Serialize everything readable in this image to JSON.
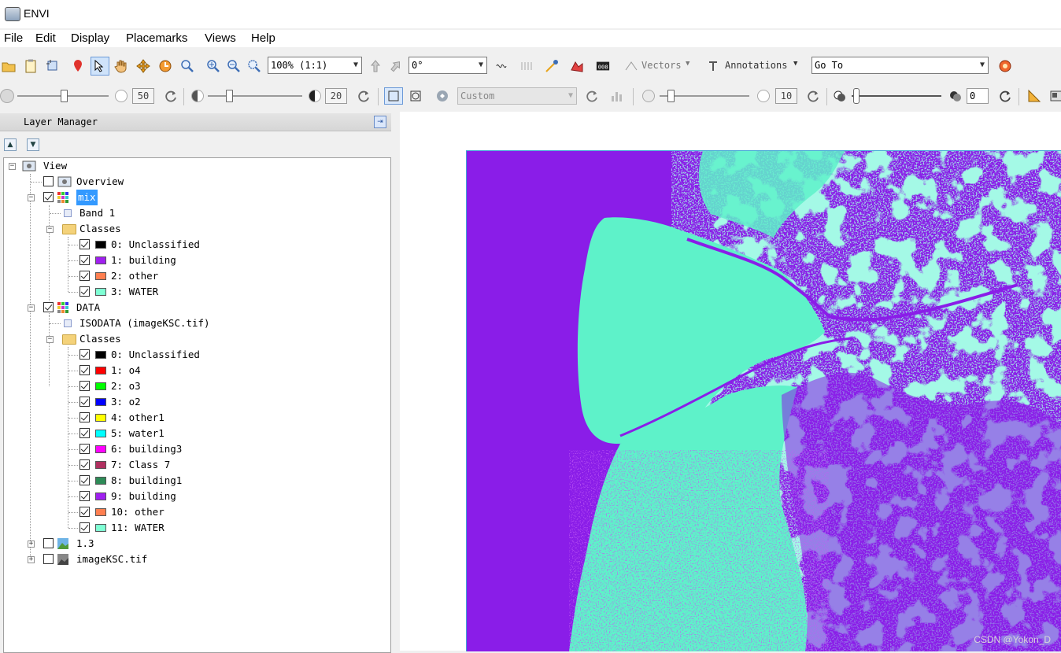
{
  "window": {
    "title": "ENVI"
  },
  "menu": [
    "File",
    "Edit",
    "Display",
    "Placemarks",
    "Views",
    "Help"
  ],
  "toolbar": {
    "zoom_value": "100% (1:1)",
    "rotation_value": "0°",
    "vectors_label": "Vectors",
    "annotations_label": "Annotations",
    "goto_value": "Go To",
    "brightness_value": "50",
    "contrast_value": "20",
    "stretch_value": "Custom",
    "sharpen_value": "10",
    "transparency_value": "0"
  },
  "layer_manager": {
    "title": "Layer Manager",
    "root": "View",
    "overview": "Overview",
    "mix": {
      "name": "mix",
      "band": "Band 1",
      "classes_label": "Classes",
      "classes": [
        {
          "label": "0: Unclassified",
          "color": "#000000"
        },
        {
          "label": "1: building",
          "color": "#a020f0"
        },
        {
          "label": "2: other",
          "color": "#ff7f50"
        },
        {
          "label": "3: WATER",
          "color": "#7fffd4"
        }
      ]
    },
    "data": {
      "name": "DATA",
      "band": "ISODATA (imageKSC.tif)",
      "classes_label": "Classes",
      "classes": [
        {
          "label": "0: Unclassified",
          "color": "#000000"
        },
        {
          "label": "1: o4",
          "color": "#ff0000"
        },
        {
          "label": "2: o3",
          "color": "#00ff00"
        },
        {
          "label": "3: o2",
          "color": "#0000ff"
        },
        {
          "label": "4: other1",
          "color": "#ffff00"
        },
        {
          "label": "5: water1",
          "color": "#00ffff"
        },
        {
          "label": "6: building3",
          "color": "#ff00ff"
        },
        {
          "label": "7: Class 7",
          "color": "#b03060"
        },
        {
          "label": "8: building1",
          "color": "#2e8b57"
        },
        {
          "label": "9: building",
          "color": "#a020f0"
        },
        {
          "label": "10: other",
          "color": "#ff7f50"
        },
        {
          "label": "11: WATER",
          "color": "#7fffd4"
        }
      ]
    },
    "other_layers": [
      "1.3",
      "imageKSC.tif"
    ]
  },
  "view": {
    "colors": {
      "building": "#8a1de8",
      "water": "#5ef2c9"
    },
    "watermark": "CSDN @Yokon_D"
  }
}
